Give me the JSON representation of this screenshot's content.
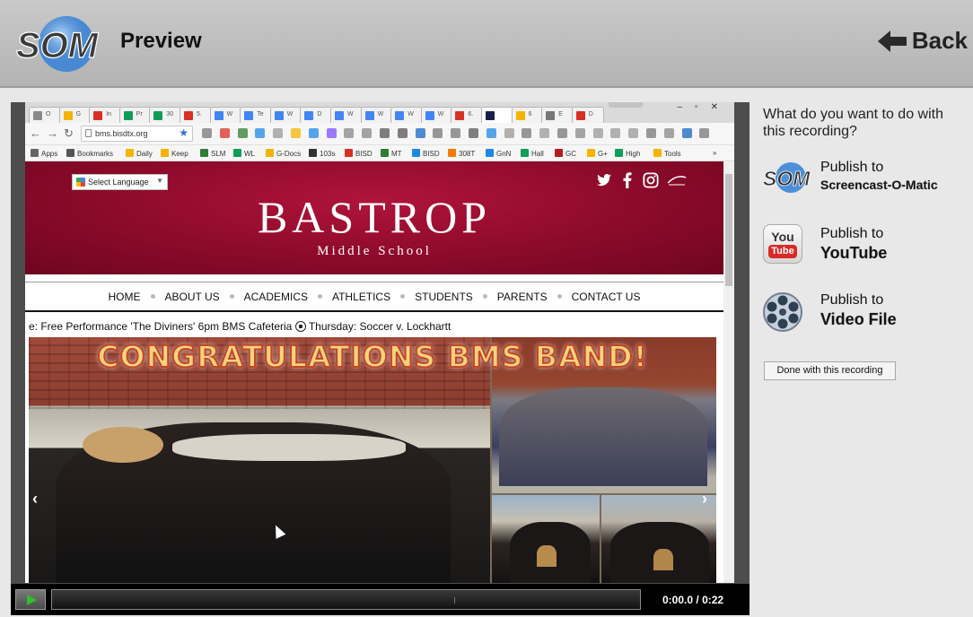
{
  "app": {
    "title": "Preview",
    "back_label": "Back",
    "logo_text": "SOM"
  },
  "browser": {
    "tabs": [
      "O",
      "G",
      "In",
      "Pr",
      "30",
      "5.",
      "W",
      "Te",
      "W",
      "D",
      "W",
      "W",
      "W",
      "W",
      "6.",
      "",
      "6",
      "E",
      "D"
    ],
    "url": "bms.bisdtx.org",
    "bookmarks": [
      "Apps",
      "Bookmarks",
      "Daily",
      "Keep",
      "SLM",
      "WL",
      "G-Docs",
      "103s",
      "BISD",
      "MT",
      "BISD",
      "308T",
      "GnN",
      "Hall",
      "GC",
      "G+",
      "High",
      "Tools"
    ],
    "more_bookmarks": "»"
  },
  "website": {
    "translate_label": "Select Language",
    "school_name": "BASTROP",
    "school_sub": "Middle School",
    "nav": [
      "HOME",
      "ABOUT US",
      "ACADEMICS",
      "ATHLETICS",
      "STUDENTS",
      "PARENTS",
      "CONTACT US"
    ],
    "ticker_before": "e: Free Performance 'The Diviners' 6pm BMS Cafeteria ",
    "ticker_after": " Thursday: Soccer v. Lockhartt",
    "slide_headline": "CONGRATULATIONS BMS BAND!",
    "prev_arrow": "‹",
    "next_arrow": "›"
  },
  "player": {
    "current_time": "0:00.0",
    "separator": "/",
    "duration": "0:22",
    "progress": 0
  },
  "panel": {
    "prompt": "What do you want to do with this recording?",
    "options": [
      {
        "line1": "Publish to",
        "line2": "Screencast-O-Matic",
        "icon": "som-icon"
      },
      {
        "line1": "Publish to",
        "line2": "YouTube",
        "icon": "youtube-icon"
      },
      {
        "line1": "Publish to",
        "line2": "Video File",
        "icon": "film-reel-icon"
      }
    ],
    "youtube_icon_top": "You",
    "youtube_icon_bottom": "Tube",
    "done_label": "Done with this recording"
  },
  "colors": {
    "banner": "#8c0a2a",
    "play_green": "#2ec02e",
    "headline": "#f6d37a"
  }
}
